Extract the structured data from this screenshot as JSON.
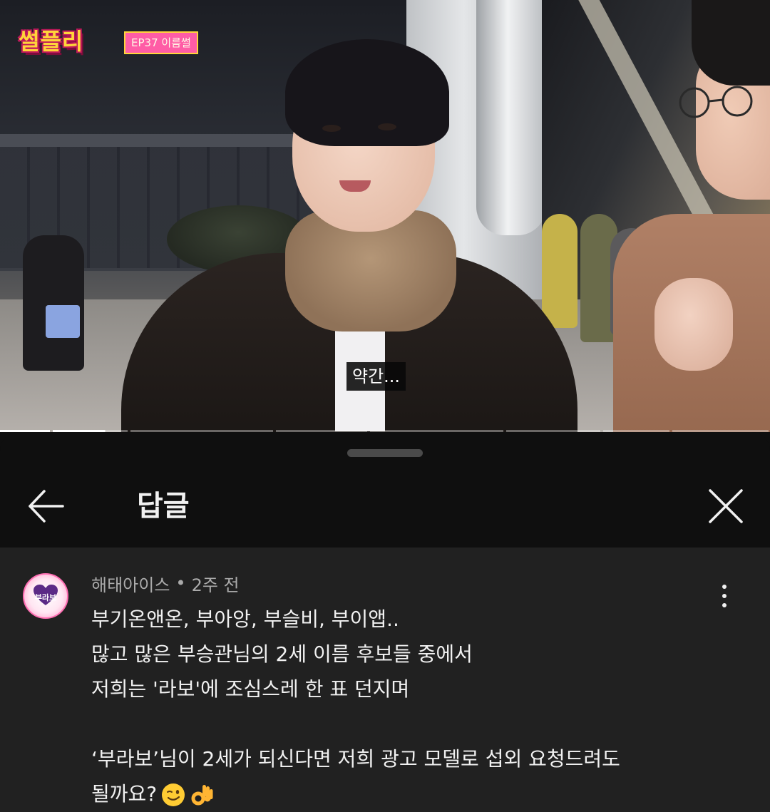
{
  "video": {
    "show_logo": "썰플리",
    "episode_badge": "EP37 이름썰",
    "subtitle": "약간...",
    "chapters": [
      {
        "played": 1.0,
        "weight": 70
      },
      {
        "played": 0.7,
        "weight": 105
      },
      {
        "played": 0.0,
        "weight": 200
      },
      {
        "played": 0.0,
        "weight": 128
      },
      {
        "played": 0.0,
        "weight": 187
      },
      {
        "played": 0.0,
        "weight": 132
      },
      {
        "played": 0.0,
        "weight": 93
      },
      {
        "played": 0.0,
        "weight": 135
      }
    ]
  },
  "sheet": {
    "title": "답글",
    "back_icon": "arrow-left-icon",
    "close_icon": "close-icon"
  },
  "comment": {
    "author": "해태아이스",
    "separator": "•",
    "time": "2주 전",
    "avatar_label": "부라보",
    "lines": [
      "부기온앤온, 부아앙, 부슬비, 부이앱..",
      "많고 많은 부승관님의 2세 이름 후보들 중에서",
      "저희는 '라보'에 조심스레 한 표 던지며",
      "",
      "‘부라보’님이 2세가 되신다면 저희 광고 모델로 섭외 요청드려도",
      "될까요?"
    ],
    "trailing_emojis": [
      "winking-face-emoji",
      "ok-hand-emoji"
    ]
  },
  "colors": {
    "sheet_bg": "#0f0f0f",
    "comment_bg": "#212121",
    "text_primary": "#f1f1f1",
    "text_secondary": "#aaaaaa",
    "badge_pink": "#ff5ca6",
    "logo_yellow": "#ffd53a"
  }
}
